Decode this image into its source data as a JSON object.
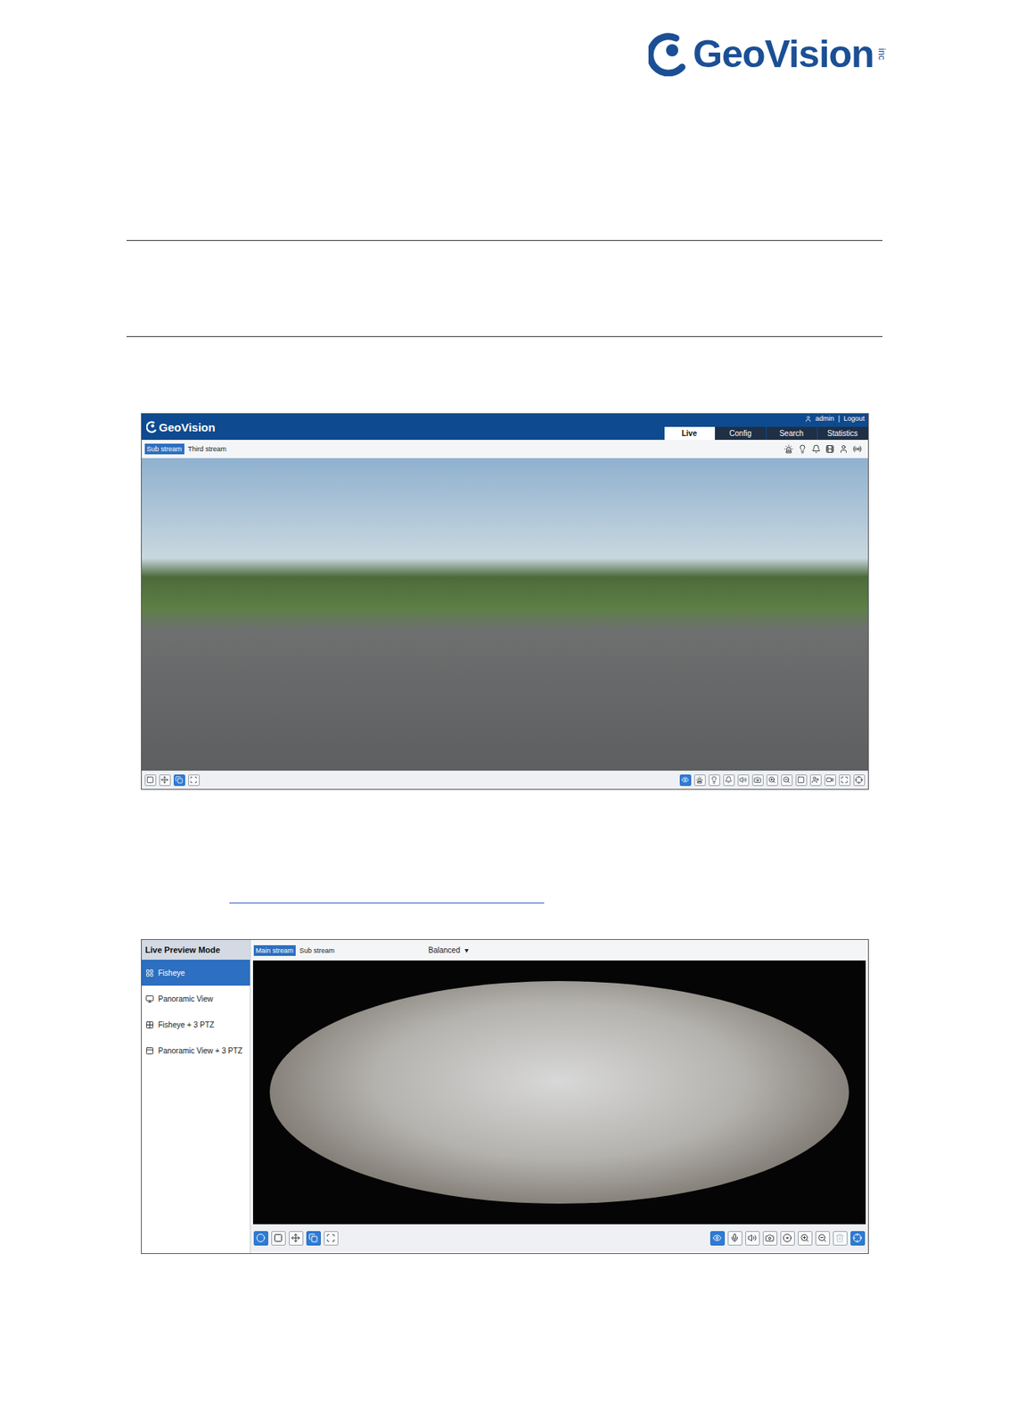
{
  "brand": {
    "name": "GeoVision",
    "suffix": "inc"
  },
  "live_screen": {
    "brand": "GeoVision",
    "user": "admin",
    "separator": "|",
    "logout": "Logout",
    "tabs": [
      {
        "label": "Live",
        "selected": true
      },
      {
        "label": "Config",
        "selected": false
      },
      {
        "label": "Search",
        "selected": false
      },
      {
        "label": "Statistics",
        "selected": false
      }
    ],
    "streams": [
      {
        "label": "Sub stream",
        "selected": true
      },
      {
        "label": "Third stream",
        "selected": false
      }
    ],
    "header_tools": [
      {
        "active": false
      },
      {
        "active": false
      },
      {
        "active": false
      },
      {
        "active": false
      },
      {
        "active": false
      },
      {
        "active": false
      }
    ],
    "left_tools": [
      {
        "active": false
      },
      {
        "active": false
      },
      {
        "active": true
      },
      {
        "active": false
      }
    ],
    "right_tools": [
      {
        "active": true
      },
      {
        "active": false
      },
      {
        "active": false
      },
      {
        "active": false
      },
      {
        "active": false
      },
      {
        "active": false
      },
      {
        "active": false
      },
      {
        "active": false
      },
      {
        "active": false
      },
      {
        "active": false
      },
      {
        "active": false
      },
      {
        "active": false
      },
      {
        "active": false
      }
    ]
  },
  "fisheye_screen": {
    "sidebar": {
      "title": "Live Preview Mode",
      "items": [
        {
          "label": "Fisheye",
          "selected": true
        },
        {
          "label": "Panoramic View",
          "selected": false
        },
        {
          "label": "Fisheye + 3 PTZ",
          "selected": false
        },
        {
          "label": "Panoramic View + 3 PTZ",
          "selected": false
        }
      ]
    },
    "streams": [
      {
        "label": "Main stream",
        "selected": true
      },
      {
        "label": "Sub stream",
        "selected": false
      }
    ],
    "quality": "Balanced",
    "caret": "▾",
    "left_tools": [
      {
        "active": true,
        "disabled": false
      },
      {
        "active": false,
        "disabled": false
      },
      {
        "active": false,
        "disabled": false
      },
      {
        "active": true,
        "disabled": false
      },
      {
        "active": false,
        "disabled": false
      }
    ],
    "right_tools": [
      {
        "active": true,
        "disabled": false
      },
      {
        "active": false,
        "disabled": false
      },
      {
        "active": false,
        "disabled": false
      },
      {
        "active": false,
        "disabled": false
      },
      {
        "active": false,
        "disabled": false
      },
      {
        "active": false,
        "disabled": false
      },
      {
        "active": false,
        "disabled": false
      },
      {
        "active": false,
        "disabled": true
      },
      {
        "active": true,
        "disabled": false
      }
    ]
  }
}
